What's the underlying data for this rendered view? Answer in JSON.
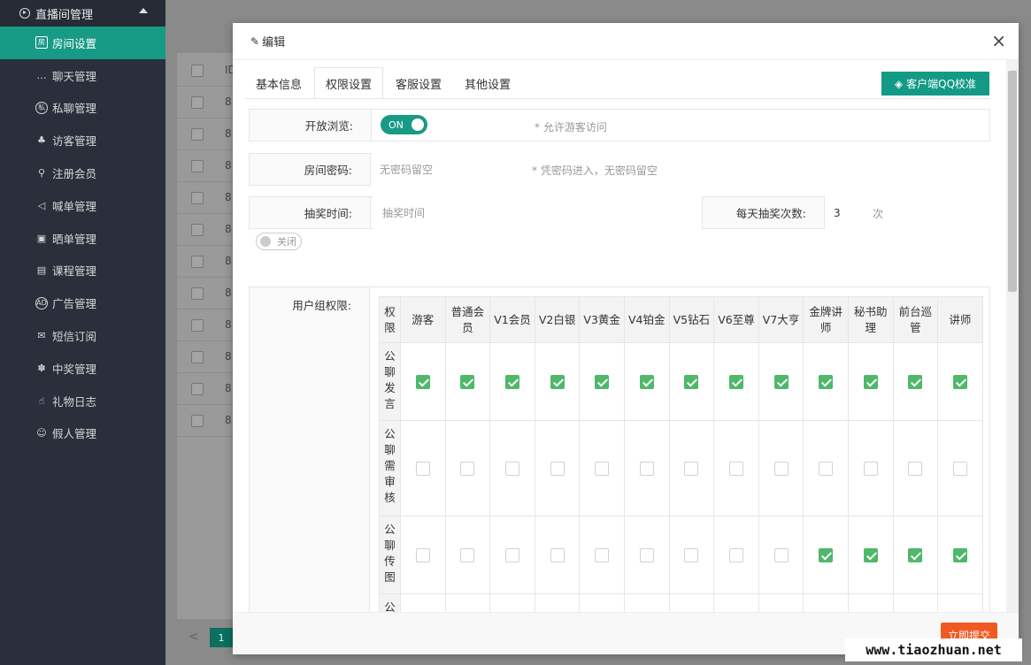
{
  "sidebar": {
    "group": "直播间管理",
    "items": [
      {
        "label": "房间设置",
        "icon": "room-settings-icon",
        "glyph": "房",
        "active": true
      },
      {
        "label": "聊天管理",
        "icon": "chat-icon",
        "glyph": "…"
      },
      {
        "label": "私聊管理",
        "icon": "private-chat-icon",
        "glyph": "私"
      },
      {
        "label": "访客管理",
        "icon": "visitor-icon",
        "glyph": "♣"
      },
      {
        "label": "注册会员",
        "icon": "user-icon",
        "glyph": "⚲"
      },
      {
        "label": "喊单管理",
        "icon": "megaphone-icon",
        "glyph": "◁"
      },
      {
        "label": "晒单管理",
        "icon": "image-icon",
        "glyph": "▣"
      },
      {
        "label": "课程管理",
        "icon": "course-icon",
        "glyph": "▤"
      },
      {
        "label": "广告管理",
        "icon": "ad-icon",
        "glyph": "AD"
      },
      {
        "label": "短信订阅",
        "icon": "mail-icon",
        "glyph": "✉"
      },
      {
        "label": "中奖管理",
        "icon": "prize-icon",
        "glyph": "✽"
      },
      {
        "label": "礼物日志",
        "icon": "thumbs-up-icon",
        "glyph": "☝"
      },
      {
        "label": "假人管理",
        "icon": "robot-icon",
        "glyph": "☺"
      }
    ]
  },
  "background": {
    "col_header": "ID",
    "row_prefix": "8",
    "page": "1",
    "prev": "<"
  },
  "modal": {
    "title": "编辑",
    "close": "×",
    "tabs": [
      "基本信息",
      "权限设置",
      "客服设置",
      "其他设置"
    ],
    "active_tab": 1,
    "qq_button": "客户端QQ校准",
    "browse": {
      "label": "开放浏览:",
      "toggle": "ON",
      "hint": "* 允许游客访问"
    },
    "password": {
      "label": "房间密码:",
      "placeholder": "无密码留空",
      "hint": "* 凭密码进入，无密码留空"
    },
    "lottery": {
      "label": "抽奖时间:",
      "placeholder": "抽奖时间",
      "daily_label": "每天抽奖次数:",
      "daily_value": "3",
      "unit": "次",
      "toggle": "关闭"
    },
    "perm": {
      "label": "用户组权限:",
      "corner": "权限",
      "columns": [
        "游客",
        "普通会员",
        "V1会员",
        "V2白银",
        "V3黄金",
        "V4铂金",
        "V5钻石",
        "V6至尊",
        "V7大亨",
        "金牌讲师",
        "秘书助理",
        "前台巡管",
        "讲师"
      ],
      "rows": [
        {
          "name": "公聊发言",
          "checked": [
            true,
            true,
            true,
            true,
            true,
            true,
            true,
            true,
            true,
            true,
            true,
            true,
            true
          ]
        },
        {
          "name": "公聊需审核",
          "checked": [
            false,
            false,
            false,
            false,
            false,
            false,
            false,
            false,
            false,
            false,
            false,
            false,
            false
          ]
        },
        {
          "name": "公聊传图",
          "checked": [
            false,
            false,
            false,
            false,
            false,
            false,
            false,
            false,
            false,
            true,
            true,
            true,
            true
          ]
        },
        {
          "name": "公聊",
          "checked": [
            false,
            false,
            false,
            false,
            false,
            false,
            false,
            false,
            false,
            true,
            true,
            true,
            true
          ]
        }
      ]
    },
    "submit": "立即提交"
  },
  "watermark": "www.tiaozhuan.net"
}
